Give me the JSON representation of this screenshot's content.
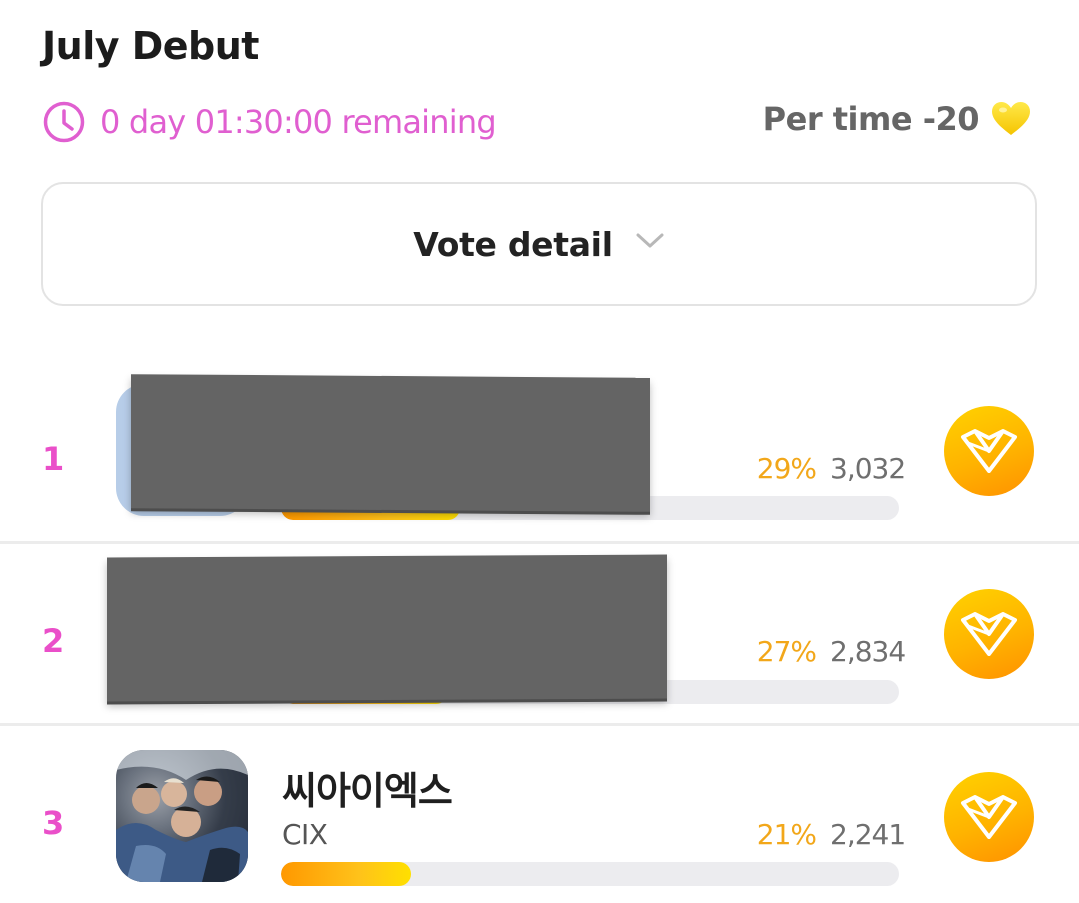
{
  "header": {
    "title": "July Debut",
    "timer_text": "0 day 01:30:00 remaining",
    "per_time_text": "Per time -20"
  },
  "vote_detail": {
    "label": "Vote detail"
  },
  "entries": [
    {
      "rank": "1",
      "name": "",
      "sub": "",
      "percent_text": "29%",
      "count": "3,032",
      "progress": 0.29,
      "redacted": true
    },
    {
      "rank": "2",
      "name": "",
      "sub": "",
      "percent_text": "27%",
      "count": "2,834",
      "progress": 0.27,
      "redacted": true
    },
    {
      "rank": "3",
      "name": "씨아이엑스",
      "sub": "CIX",
      "percent_text": "21%",
      "count": "2,241",
      "progress": 0.21,
      "redacted": false
    }
  ],
  "colors": {
    "accent_pink": "#e05fd0",
    "rank_pink": "#ea4fc9",
    "percent_orange": "#f2a71a",
    "heart_yellow": "#ffd400",
    "button_gradient_start": "#ffd200",
    "button_gradient_end": "#ff9100"
  },
  "icons": {
    "timer": "clock-icon",
    "per_time": "heart-icon",
    "vote_detail": "chevron-down-icon",
    "vote_button": "heart-logo-icon"
  }
}
